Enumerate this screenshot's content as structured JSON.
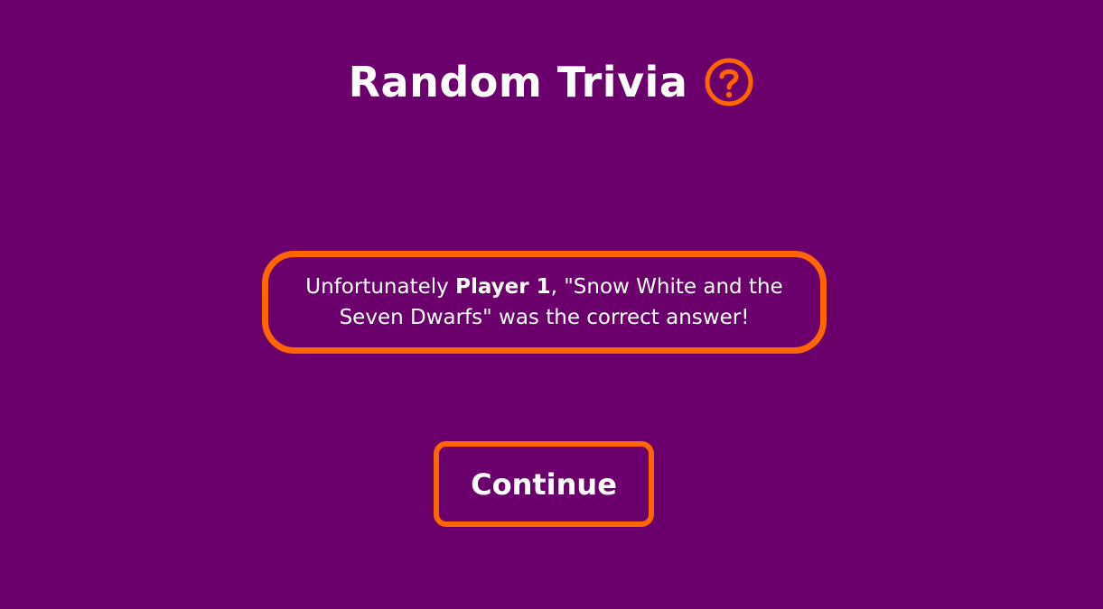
{
  "header": {
    "title": "Random Trivia",
    "help_icon": "question-circle-icon"
  },
  "result": {
    "prefix": "Unfortunately ",
    "player_name": "Player 1",
    "suffix": ", \"Snow White and the Seven Dwarfs\" was the correct answer!"
  },
  "actions": {
    "continue_label": "Continue"
  },
  "colors": {
    "background": "#6b006c",
    "accent": "#ff6600",
    "text": "#ffffff"
  }
}
